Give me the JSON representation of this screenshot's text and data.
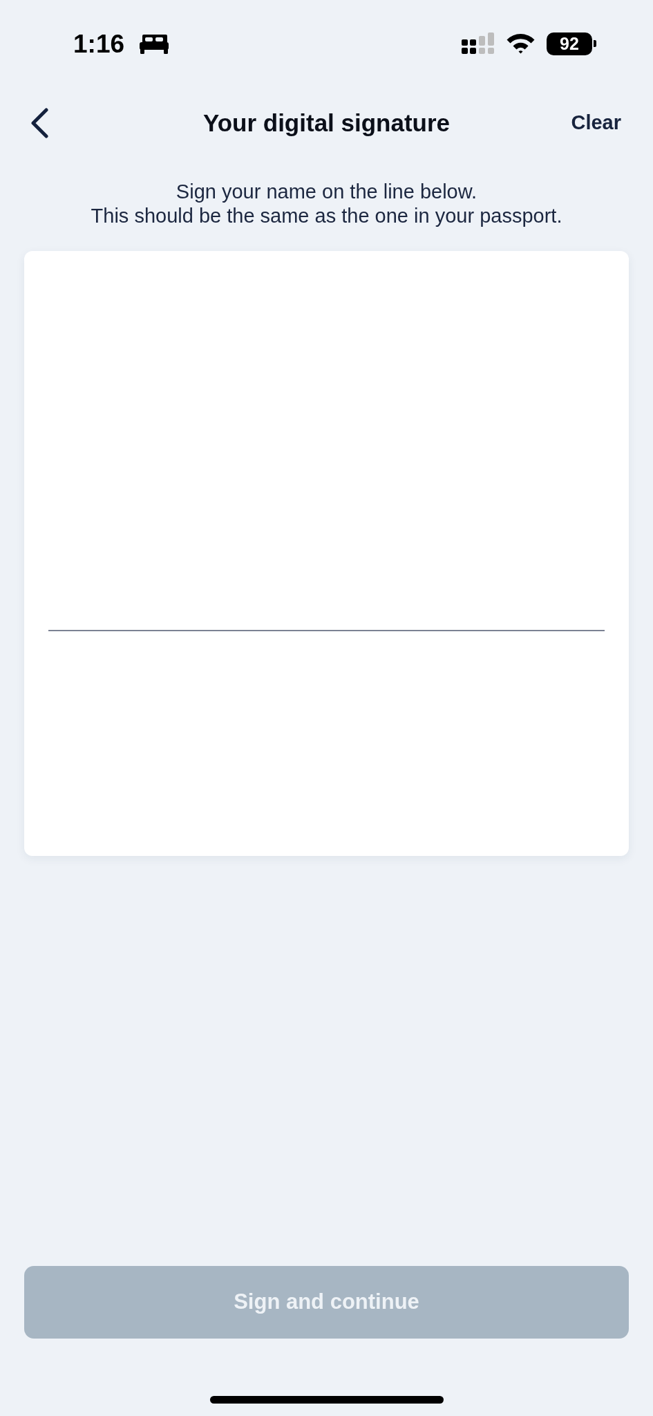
{
  "status_bar": {
    "time": "1:16",
    "battery": "92"
  },
  "header": {
    "title": "Your digital signature",
    "action": "Clear"
  },
  "instructions": [
    "Sign your name on the line below.",
    "This should be the same as the one in your passport."
  ],
  "primary_button": {
    "label": "Sign and continue",
    "disabled": true
  }
}
